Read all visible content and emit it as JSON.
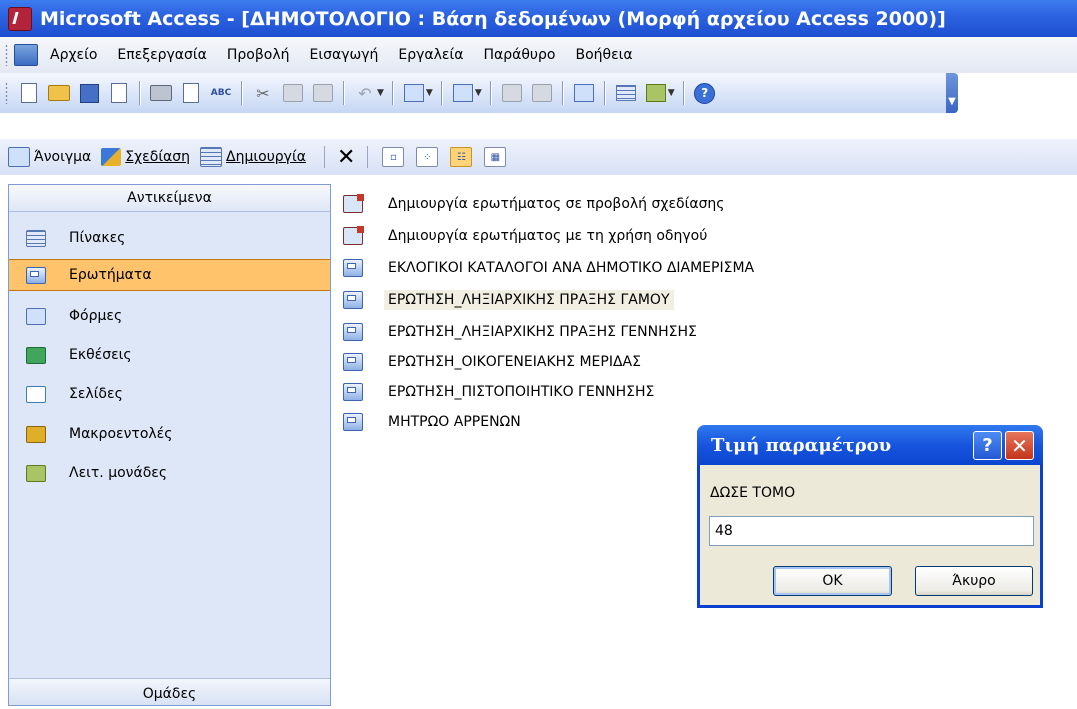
{
  "window": {
    "title": "Microsoft Access - [ΔΗΜΟΤΟΛΟΓΙΟ : Βάση δεδομένων (Μορφή αρχείου Access 2000)]"
  },
  "menu": {
    "items": [
      "Αρχείο",
      "Επεξεργασία",
      "Προβολή",
      "Εισαγωγή",
      "Εργαλεία",
      "Παράθυρο",
      "Βοήθεια"
    ]
  },
  "toolbar": {
    "spell_label": "ABC",
    "help_label": "?"
  },
  "db_toolbar": {
    "open_label": "Άνοιγμα",
    "design_label": "Σχεδίαση",
    "new_label": "Δημιουργία"
  },
  "objects": {
    "header": "Αντικείμενα",
    "items": [
      {
        "label": "Πίνακες",
        "icon": "table-icon"
      },
      {
        "label": "Ερωτήματα",
        "icon": "query-icon",
        "selected": true
      },
      {
        "label": "Φόρμες",
        "icon": "form-icon"
      },
      {
        "label": "Εκθέσεις",
        "icon": "report-icon"
      },
      {
        "label": "Σελίδες",
        "icon": "page-icon"
      },
      {
        "label": "Μακροεντολές",
        "icon": "macro-icon"
      },
      {
        "label": "Λειτ. μονάδες",
        "icon": "module-icon"
      }
    ],
    "groups_label": "Ομάδες"
  },
  "queries": {
    "items": [
      {
        "label": "Δημιουργία ερωτήματος σε προβολή σχεδίασης",
        "icon": "wizard-icon"
      },
      {
        "label": "Δημιουργία ερωτήματος με τη χρήση οδηγού",
        "icon": "wizard-icon"
      },
      {
        "label": "ΕΚΛΟΓΙΚΟΙ ΚΑΤΑΛΟΓΟΙ ΑΝΑ ΔΗΜΟΤΙΚΟ ΔΙΑΜΕΡΙΣΜΑ",
        "icon": "query-icon"
      },
      {
        "label": "ΕΡΩΤΗΣΗ_ΛΗΞΙΑΡΧΙΚΗΣ ΠΡΑΞΗΣ ΓΑΜΟΥ",
        "icon": "query-icon",
        "highlighted": true
      },
      {
        "label": "ΕΡΩΤΗΣΗ_ΛΗΞΙΑΡΧΙΚΗΣ ΠΡΑΞΗΣ ΓΕΝΝΗΣΗΣ",
        "icon": "query-icon"
      },
      {
        "label": "ΕΡΩΤΗΣΗ_ΟΙΚΟΓΕΝΕΙΑΚΗΣ ΜΕΡΙΔΑΣ",
        "icon": "query-icon"
      },
      {
        "label": "ΕΡΩΤΗΣΗ_ΠΙΣΤΟΠΟΙΗΤΙΚΟ ΓΕΝΝΗΣΗΣ",
        "icon": "query-icon"
      },
      {
        "label": "ΜΗΤΡΩΟ ΑΡΡΕΝΩΝ",
        "icon": "query-icon"
      }
    ]
  },
  "dialog": {
    "title": "Τιμή παραμέτρου",
    "help_label": "?",
    "close_label": "✕",
    "prompt": "ΔΩΣΕ ΤΟΜΟ",
    "value": "48",
    "ok_label": "OK",
    "cancel_label": "Άκυρο"
  },
  "colors": {
    "titlebar": "#2b61df",
    "selected_item": "#ffc46b",
    "panel_bg": "#dde7f7",
    "dialog_bg": "#ece9d8"
  }
}
